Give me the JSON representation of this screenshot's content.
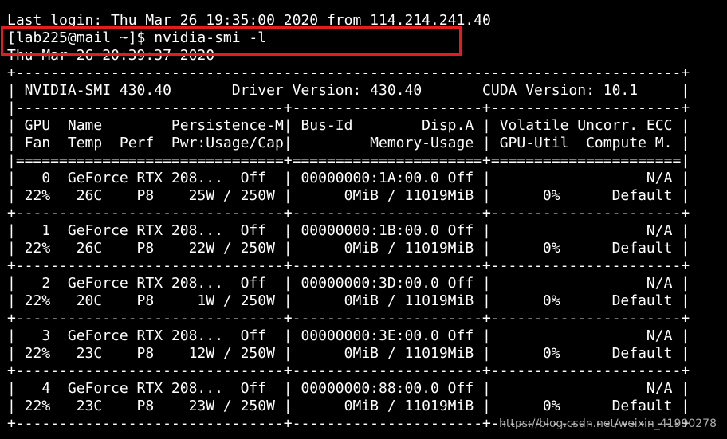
{
  "terminal": {
    "lines": [
      "Last login: Thu Mar 26 19:35:00 2020 from 114.214.241.40",
      "[lab225@mail ~]$ nvidia-smi -l",
      "Thu Mar 26 20:39:37 2020",
      "+-----------------------------------------------------------------------------+",
      "| NVIDIA-SMI 430.40       Driver Version: 430.40       CUDA Version: 10.1     |",
      "|-------------------------------+----------------------+----------------------+",
      "| GPU  Name        Persistence-M| Bus-Id        Disp.A | Volatile Uncorr. ECC |",
      "| Fan  Temp  Perf  Pwr:Usage/Cap|         Memory-Usage | GPU-Util  Compute M. |",
      "|===============================+======================+======================|",
      "|   0  GeForce RTX 208...  Off  | 00000000:1A:00.0 Off |                  N/A |",
      "| 22%   26C    P8    25W / 250W |      0MiB / 11019MiB |      0%      Default |",
      "+-------------------------------+----------------------+----------------------+",
      "|   1  GeForce RTX 208...  Off  | 00000000:1B:00.0 Off |                  N/A |",
      "| 22%   26C    P8    22W / 250W |      0MiB / 11019MiB |      0%      Default |",
      "+-------------------------------+----------------------+----------------------+",
      "|   2  GeForce RTX 208...  Off  | 00000000:3D:00.0 Off |                  N/A |",
      "| 22%   20C    P8     1W / 250W |      0MiB / 11019MiB |      0%      Default |",
      "+-------------------------------+----------------------+----------------------+",
      "|   3  GeForce RTX 208...  Off  | 00000000:3E:00.0 Off |                  N/A |",
      "| 22%   23C    P8    12W / 250W |      0MiB / 11019MiB |      0%      Default |",
      "+-------------------------------+----------------------+----------------------+",
      "|   4  GeForce RTX 208...  Off  | 00000000:88:00.0 Off |                  N/A |",
      "| 22%   23C    P8    23W / 250W |      0MiB / 11019MiB |      0%      Default |",
      "+-------------------------------+----------------------+----------------------+"
    ]
  },
  "watermark": "https://blog.csdn.net/weixin_41990278",
  "colors": {
    "background": "#000000",
    "text": "#ffffff",
    "highlight": "#e41c1c"
  }
}
